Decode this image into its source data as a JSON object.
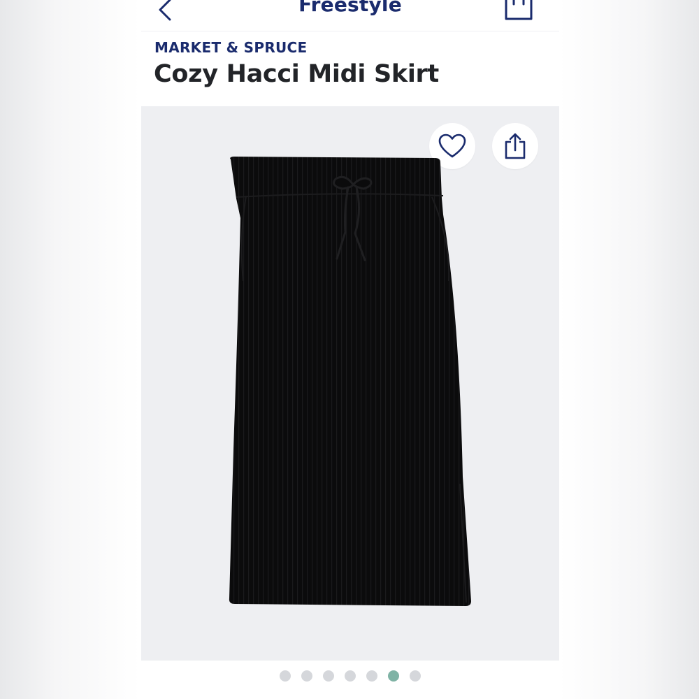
{
  "header": {
    "title": "Freestyle",
    "back_icon": "chevron-left-icon",
    "bag_icon": "shopping-bag-icon"
  },
  "product": {
    "brand": "MARKET & SPRUCE",
    "name": "Cozy Hacci Midi Skirt",
    "price_partial": ""
  },
  "gallery": {
    "favorite_icon": "heart-icon",
    "share_icon": "share-icon",
    "image": "black ribbed midi skirt with drawstring",
    "dot_count": 7,
    "active_index": 5
  },
  "colors": {
    "brand_navy": "#1a2b6d",
    "text_dark": "#222428",
    "gallery_bg": "#eeeff2",
    "dot_inactive": "#d5d7db",
    "dot_active": "#7fb3a5"
  }
}
